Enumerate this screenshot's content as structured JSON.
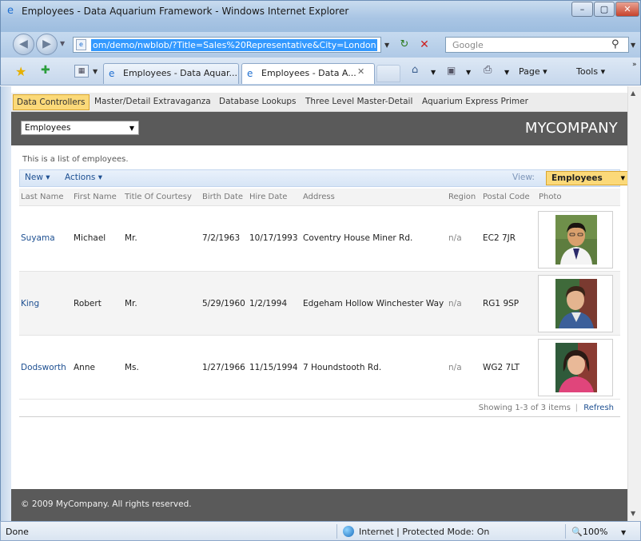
{
  "window": {
    "title": "Employees - Data Aquarium Framework - Windows Internet Explorer",
    "min": "–",
    "max": "▢",
    "close": "✕"
  },
  "navbar": {
    "back": "◀",
    "forward": "▶",
    "url": "om/demo/nwblob/?Title=Sales%20Representative&City=London",
    "search_placeholder": "Google",
    "refresh": "↻",
    "stop": "✕",
    "search_icon": "⚲"
  },
  "tabs": {
    "items": [
      {
        "label": "Employees - Data Aquar..."
      },
      {
        "label": "Employees - Data A..."
      }
    ],
    "close": "✕"
  },
  "commands": {
    "page": "Page ▾",
    "tools": "Tools ▾",
    "more": "»"
  },
  "app": {
    "menu": [
      {
        "label": "Data Controllers"
      },
      {
        "label": "Master/Detail Extravaganza"
      },
      {
        "label": "Database Lookups"
      },
      {
        "label": "Three Level Master-Detail"
      },
      {
        "label": "Aquarium Express Primer"
      }
    ],
    "controller_select": "Employees",
    "brand": "MYCOMPANY",
    "intro": "This is a list of employees.",
    "action_bar": {
      "new": "New ▾",
      "actions": "Actions ▾",
      "view_label": "View:",
      "view_value": "Employees"
    },
    "grid": {
      "columns": [
        "Last Name",
        "First Name",
        "Title Of Courtesy",
        "Birth Date",
        "Hire Date",
        "Address",
        "Region",
        "Postal Code",
        "Photo"
      ],
      "rows": [
        {
          "last_name": "Suyama",
          "first_name": "Michael",
          "courtesy": "Mr.",
          "birth_date": "7/2/1963",
          "hire_date": "10/17/1993",
          "address": "Coventry House Miner Rd.",
          "region": "n/a",
          "postal_code": "EC2 7JR"
        },
        {
          "last_name": "King",
          "first_name": "Robert",
          "courtesy": "Mr.",
          "birth_date": "5/29/1960",
          "hire_date": "1/2/1994",
          "address": "Edgeham Hollow Winchester Way",
          "region": "n/a",
          "postal_code": "RG1 9SP"
        },
        {
          "last_name": "Dodsworth",
          "first_name": "Anne",
          "courtesy": "Ms.",
          "birth_date": "1/27/1966",
          "hire_date": "11/15/1994",
          "address": "7 Houndstooth Rd.",
          "region": "n/a",
          "postal_code": "WG2 7LT"
        }
      ],
      "showing": "Showing 1-3 of 3 items",
      "refresh": "Refresh"
    },
    "footer": "© 2009 MyCompany. All rights reserved."
  },
  "status": {
    "text": "Done",
    "zone": "Internet | Protected Mode: On",
    "zoom": "100%"
  },
  "colors": {
    "accent": "#fbd979",
    "link": "#1d4f91",
    "header_bg": "#5a5a5a"
  }
}
